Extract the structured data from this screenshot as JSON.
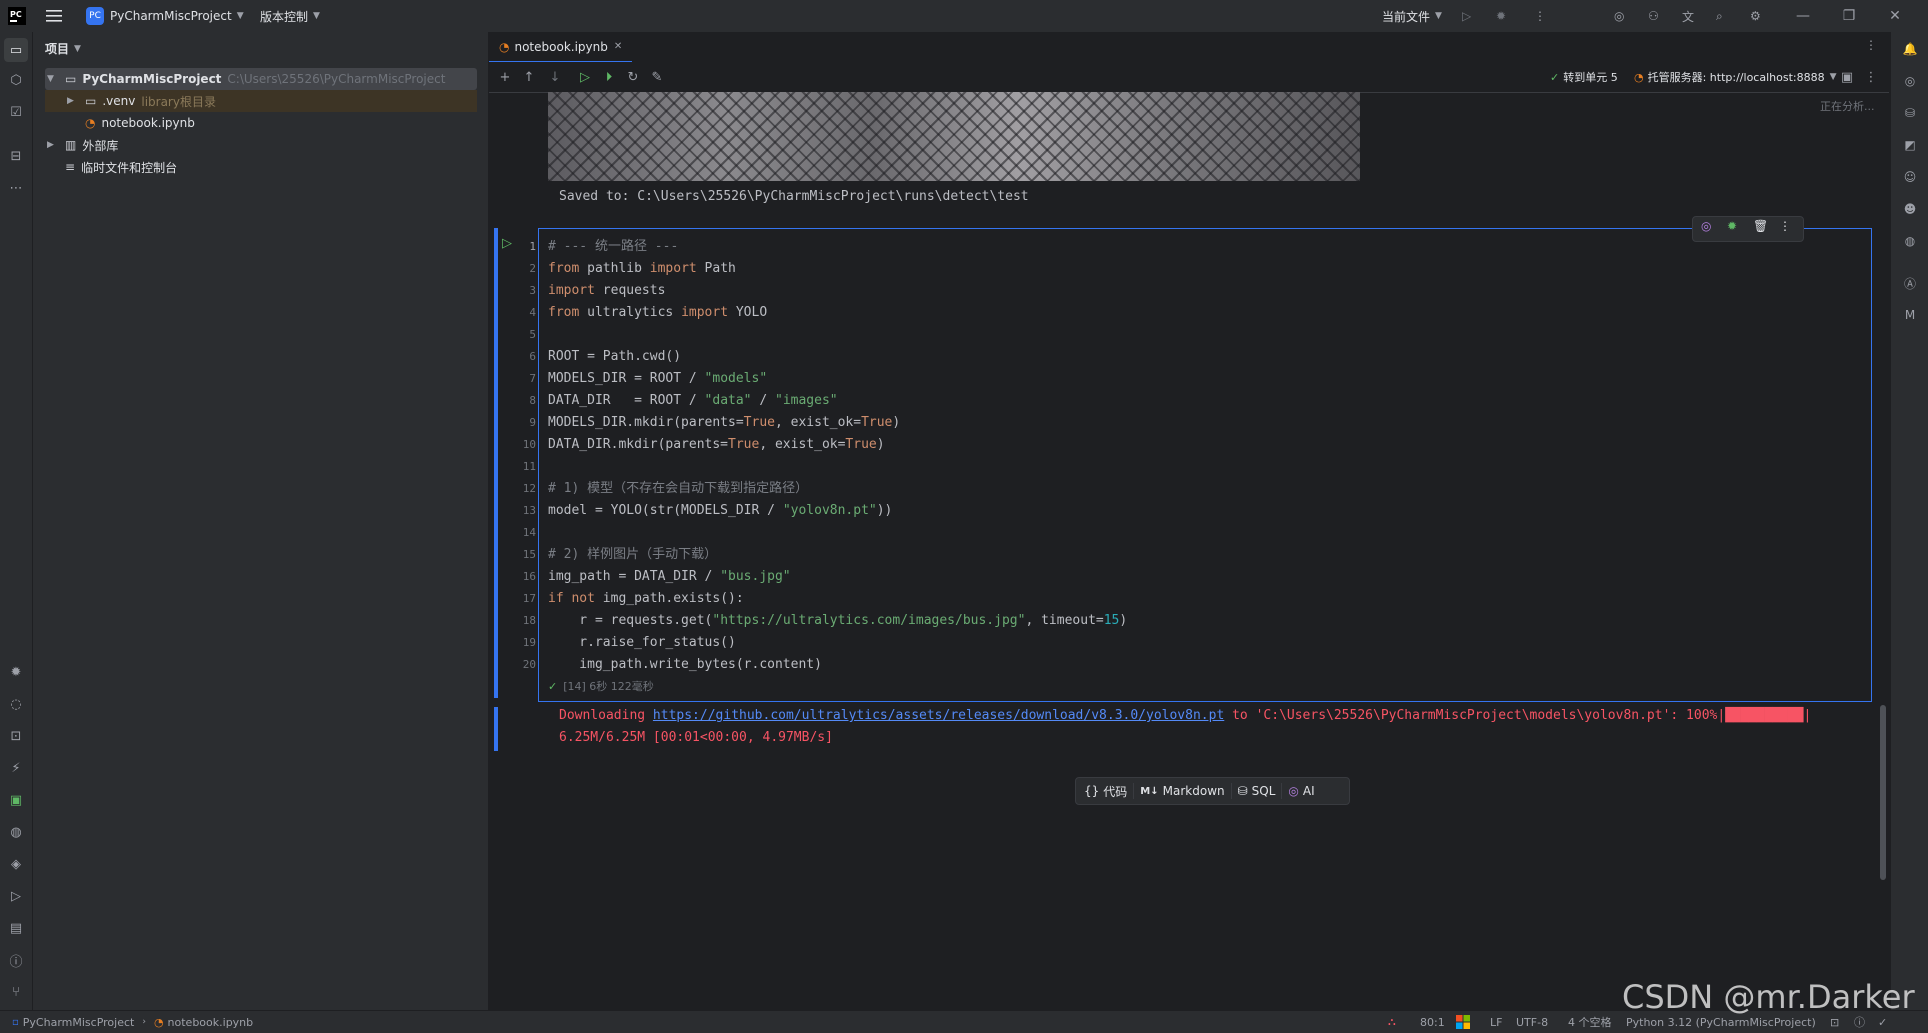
{
  "titlebar": {
    "app_badge": "PC",
    "project_name": "PyCharmMiscProject",
    "vcs_menu": "版本控制",
    "run_config": "当前文件"
  },
  "project_panel": {
    "header": "项目",
    "root_name": "PyCharmMiscProject",
    "root_path": "C:\\Users\\25526\\PyCharmMiscProject",
    "venv_name": ".venv",
    "venv_note": "library根目录",
    "notebook_file": "notebook.ipynb",
    "external_libs": "外部库",
    "scratches": "临时文件和控制台"
  },
  "editor": {
    "tab_label": "notebook.ipynb",
    "goto_cell": "转到单元 5",
    "server_label": "托管服务器: http://localhost:8888",
    "analyzing": "正在分析...",
    "saved_output": "Saved to: C:\\Users\\25526\\PyCharmMiscProject\\runs\\detect\\test",
    "code_lines": [
      "# --- 统一路径 ---",
      "from pathlib import Path",
      "import requests",
      "from ultralytics import YOLO",
      "",
      "ROOT = Path.cwd()",
      "MODELS_DIR = ROOT / \"models\"",
      "DATA_DIR   = ROOT / \"data\" / \"images\"",
      "MODELS_DIR.mkdir(parents=True, exist_ok=True)",
      "DATA_DIR.mkdir(parents=True, exist_ok=True)",
      "",
      "# 1) 模型（不存在会自动下载到指定路径）",
      "model = YOLO(str(MODELS_DIR / \"yolov8n.pt\"))",
      "",
      "# 2) 样例图片（手动下载）",
      "img_path = DATA_DIR / \"bus.jpg\"",
      "if not img_path.exists():",
      "    r = requests.get(\"https://ultralytics.com/images/bus.jpg\", timeout=15)",
      "    r.raise_for_status()",
      "    img_path.write_bytes(r.content)"
    ],
    "cell_status": "[14] 6秒 122毫秒",
    "output_prefix": "Downloading ",
    "output_link": "https://github.com/ultralytics/assets/releases/download/v8.3.0/yolov8n.pt",
    "output_rest": " to 'C:\\Users\\25526\\PyCharmMiscProject\\models\\yolov8n.pt': 100%|██████████|",
    "output_line2": "6.25M/6.25M [00:01<00:00, 4.97MB/s]",
    "add_cell": {
      "code": "代码",
      "markdown": "Markdown",
      "sql": "SQL",
      "ai": "AI"
    }
  },
  "statusbar": {
    "crumb_project": "PyCharmMiscProject",
    "crumb_file": "notebook.ipynb",
    "position": "80:1",
    "line_sep": "LF",
    "encoding": "UTF-8",
    "indent": "4 个空格",
    "interpreter": "Python 3.12 (PyCharmMiscProject)"
  },
  "watermark": "CSDN @mr.Darker",
  "colors": {
    "background": "#1e1f22",
    "panel": "#2b2d30",
    "accent": "#3574f0",
    "keyword": "#cf8e6d",
    "string": "#6aab73",
    "comment": "#7a7e85",
    "number": "#2aacb8",
    "error_output": "#f75464",
    "success": "#5fb865"
  }
}
